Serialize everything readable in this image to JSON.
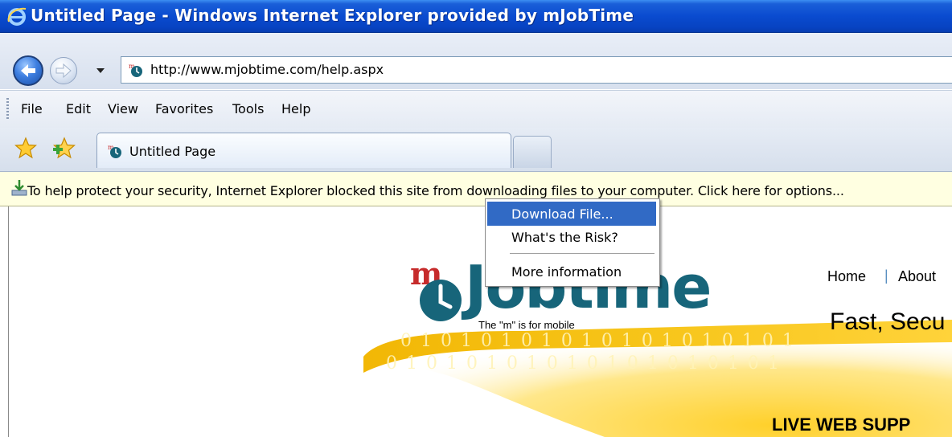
{
  "window": {
    "title": "Untitled Page - Windows Internet Explorer provided by mJobTime"
  },
  "address_bar": {
    "url": "http://www.mjobtime.com/help.aspx"
  },
  "menu": {
    "items": [
      "File",
      "Edit",
      "View",
      "Favorites",
      "Tools",
      "Help"
    ]
  },
  "tabs": {
    "active_label": "Untitled Page"
  },
  "info_bar": {
    "text": "To help protect your security, Internet Explorer blocked this site from downloading files to your computer. Click here for options..."
  },
  "context_menu": {
    "items": [
      {
        "label": "Download File...",
        "selected": true
      },
      {
        "label": "What's the Risk?",
        "selected": false
      },
      {
        "label": "More information",
        "selected": false
      }
    ]
  },
  "page": {
    "logo_m": "m",
    "logo_text": "Jobtime",
    "tagline": "The \"m\" is for mobile",
    "binary_line1": "0 1 0 1 0 1 0 1 0 1 0 1 0 1 0 1 0 1 0 1",
    "binary_line2": "0 1 0 1 0 1 0 1 0 1 0 1 0 1 0 1 0 1 0 1",
    "nav": [
      "Home",
      "About"
    ],
    "nav_separator": "|",
    "headline": "Fast, Secu",
    "live_support": "LIVE WEB SUPP"
  },
  "colors": {
    "titlebar": "#0a4bd0",
    "info_bar_bg": "#ffffe1",
    "menu_highlight": "#316ac5",
    "logo_teal": "#17657a",
    "logo_red": "#c62b2b",
    "swoosh_yellow": "#f7c51a"
  },
  "icons": {
    "browser": "ie-logo-icon",
    "back": "back-arrow-icon",
    "forward": "forward-arrow-icon",
    "favorites": "favorites-star-icon",
    "add_favorite": "add-favorite-icon",
    "site": "mjobtime-favicon-icon",
    "download_blocked": "download-blocked-icon"
  }
}
